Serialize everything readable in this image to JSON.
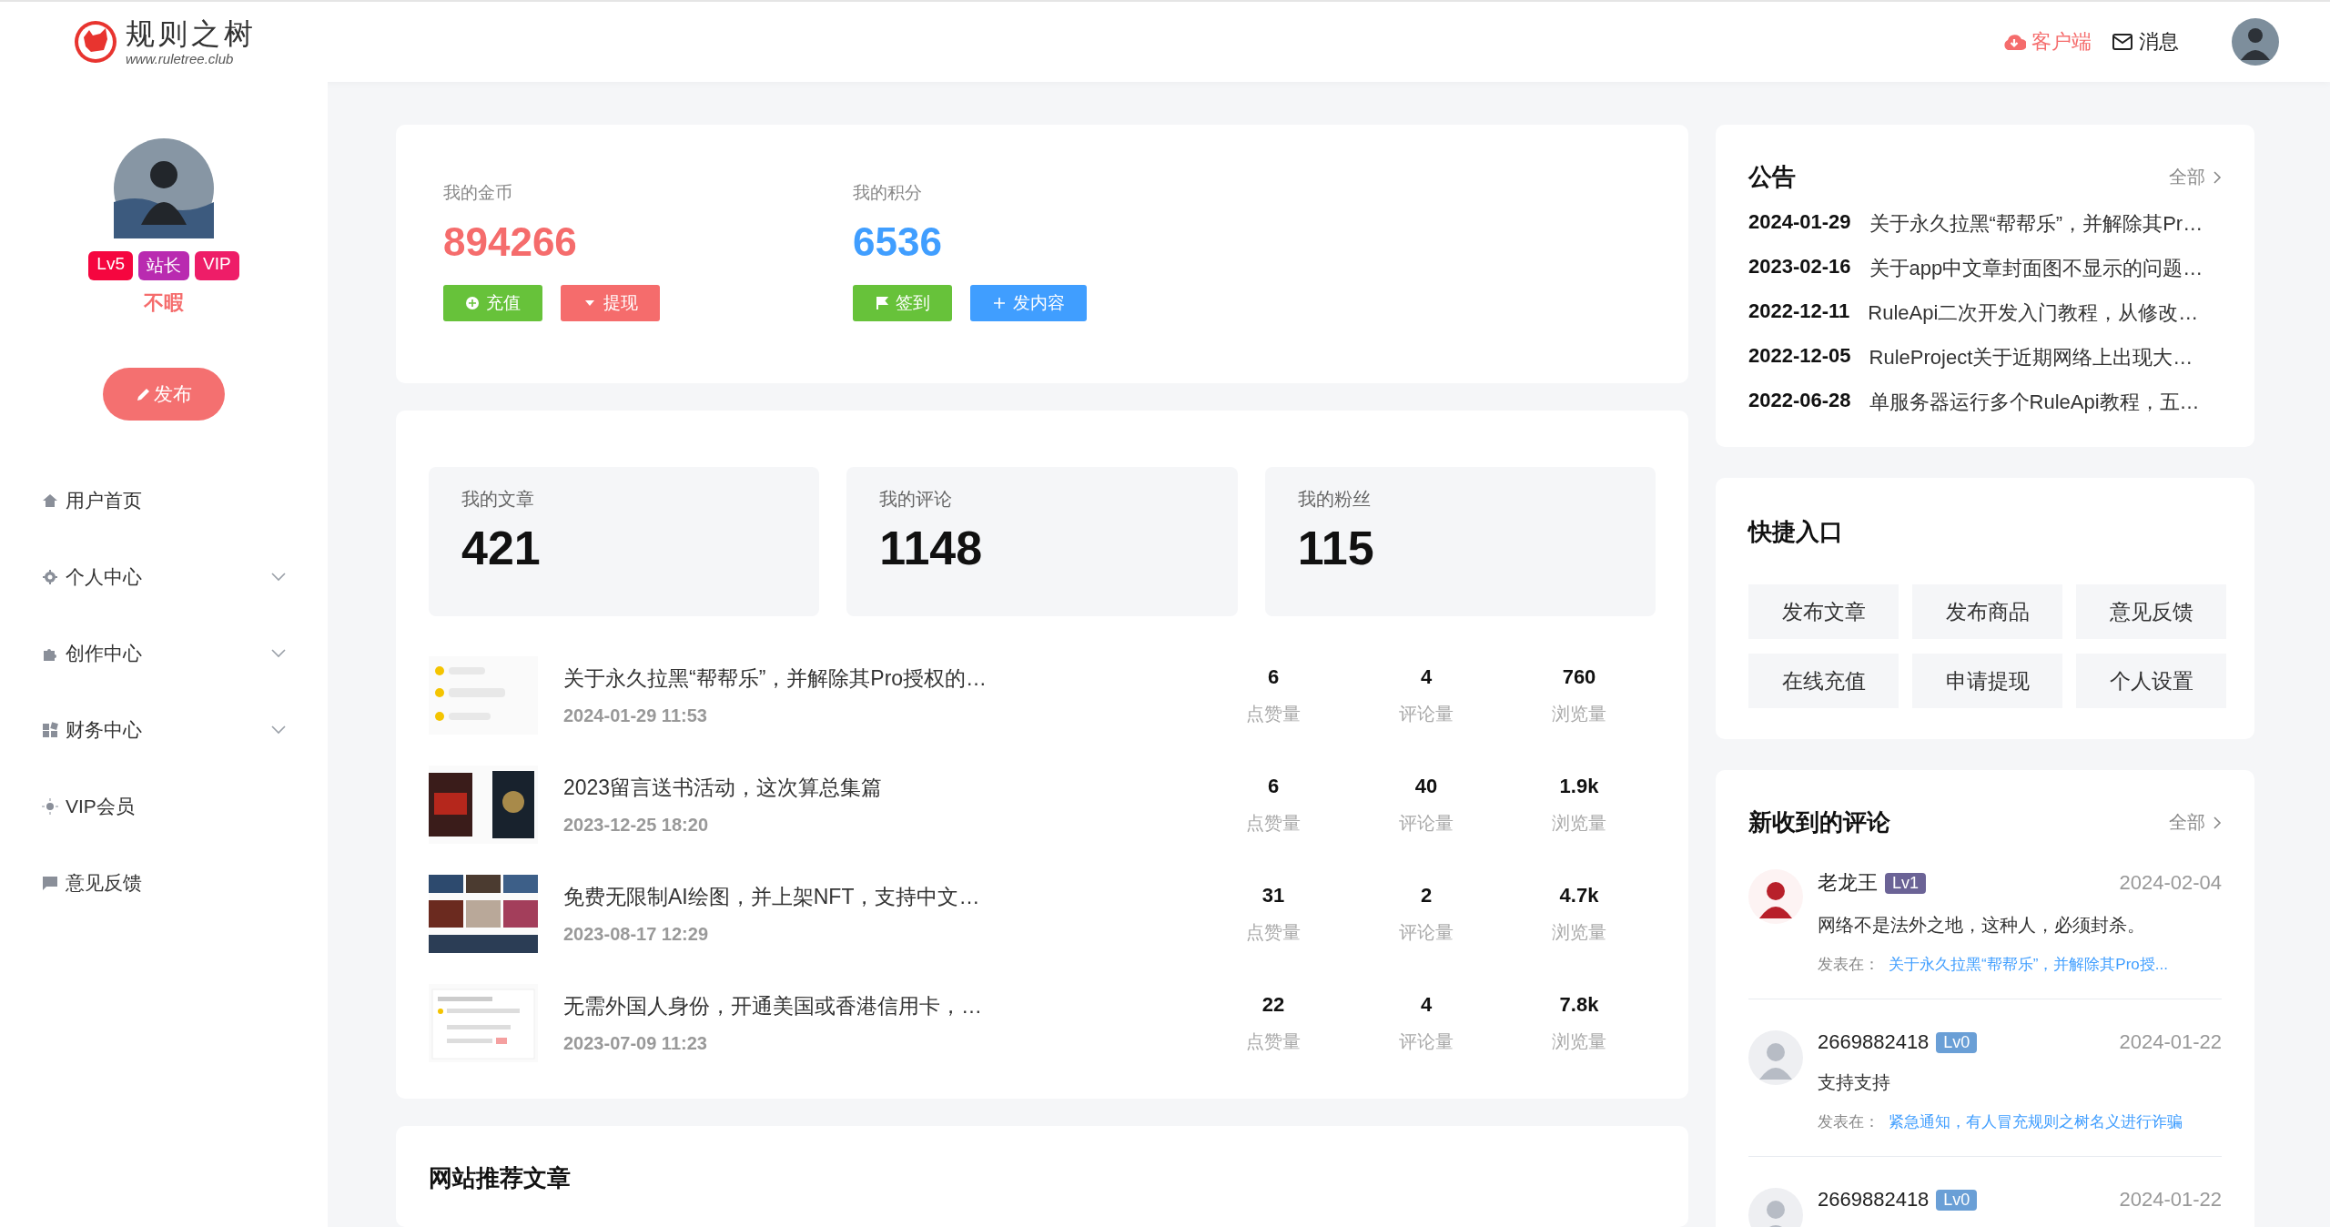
{
  "header": {
    "logo_title": "规则之树",
    "logo_url": "www.ruletree.club",
    "client_link": "客户端",
    "messages_link": "消息"
  },
  "profile": {
    "badges": [
      {
        "label": "Lv5",
        "color": "#f5063f"
      },
      {
        "label": "站长",
        "color": "#b92bb0"
      },
      {
        "label": "VIP",
        "color": "#ee1d68"
      }
    ],
    "name": "不暇",
    "publish_button": "发布"
  },
  "sidebar": {
    "items": [
      {
        "label": "用户首页",
        "expandable": false
      },
      {
        "label": "个人中心",
        "expandable": true
      },
      {
        "label": "创作中心",
        "expandable": true
      },
      {
        "label": "财务中心",
        "expandable": true
      },
      {
        "label": "VIP会员",
        "expandable": false
      },
      {
        "label": "意见反馈",
        "expandable": false
      }
    ]
  },
  "wallet": [
    {
      "label": "我的金币",
      "value": "894266",
      "color": "#f56c6c",
      "buttons": [
        {
          "label": "充值",
          "color": "#67c23a"
        },
        {
          "label": "提现",
          "color": "#f56c6c"
        }
      ]
    },
    {
      "label": "我的积分",
      "value": "6536",
      "color": "#409eff",
      "buttons": [
        {
          "label": "签到",
          "color": "#67c23a"
        },
        {
          "label": "发内容",
          "color": "#409eff"
        }
      ]
    }
  ],
  "stats": [
    {
      "label": "我的文章",
      "value": "421"
    },
    {
      "label": "我的评论",
      "value": "1148"
    },
    {
      "label": "我的粉丝",
      "value": "115"
    }
  ],
  "articles": [
    {
      "title": "关于永久拉黑“帮帮乐”，并解除其Pro授权的…",
      "date": "2024-01-29 11:53",
      "metrics": [
        {
          "value": "6",
          "label": "点赞量"
        },
        {
          "value": "4",
          "label": "评论量"
        },
        {
          "value": "760",
          "label": "浏览量"
        }
      ]
    },
    {
      "title": "2023留言送书活动，这次算总集篇",
      "date": "2023-12-25 18:20",
      "metrics": [
        {
          "value": "6",
          "label": "点赞量"
        },
        {
          "value": "40",
          "label": "评论量"
        },
        {
          "value": "1.9k",
          "label": "浏览量"
        }
      ]
    },
    {
      "title": "免费无限制AI绘图，并上架NFT，支持中文…",
      "date": "2023-08-17 12:29",
      "metrics": [
        {
          "value": "31",
          "label": "点赞量"
        },
        {
          "value": "2",
          "label": "评论量"
        },
        {
          "value": "4.7k",
          "label": "浏览量"
        }
      ]
    },
    {
      "title": "无需外国人身份，开通美国或香港信用卡，…",
      "date": "2023-07-09 11:23",
      "metrics": [
        {
          "value": "22",
          "label": "点赞量"
        },
        {
          "value": "4",
          "label": "评论量"
        },
        {
          "value": "7.8k",
          "label": "浏览量"
        }
      ]
    }
  ],
  "recommended": {
    "title": "网站推荐文章"
  },
  "notices": {
    "title": "公告",
    "more": "全部",
    "items": [
      {
        "date": "2024-01-29",
        "text": "关于永久拉黑“帮帮乐”，并解除其Pr…"
      },
      {
        "date": "2023-02-16",
        "text": "关于app中文章封面图不显示的问题…"
      },
      {
        "date": "2022-12-11",
        "text": "RuleApi二次开发入门教程，从修改…"
      },
      {
        "date": "2022-12-05",
        "text": "RuleProject关于近期网络上出现大…"
      },
      {
        "date": "2022-06-28",
        "text": "单服务器运行多个RuleApi教程，五…"
      }
    ]
  },
  "quick": {
    "title": "快捷入口",
    "buttons": [
      "发布文章",
      "发布商品",
      "意见反馈",
      "在线充值",
      "申请提现",
      "个人设置"
    ]
  },
  "comments": {
    "title": "新收到的评论",
    "more": "全部",
    "items": [
      {
        "user": "老龙王",
        "level": "Lv1",
        "color": "#6b6396",
        "date": "2024-02-04",
        "text": "网络不是法外之地，这种人，必须封杀。",
        "posted_label": "发表在：",
        "post_title": "关于永久拉黑“帮帮乐”，并解除其Pro授..."
      },
      {
        "user": "2669882418",
        "level": "Lv0",
        "color": "#6a9fd6",
        "date": "2024-01-22",
        "text": "支持支持",
        "posted_label": "发表在：",
        "post_title": "紧急通知，有人冒充规则之树名义进行诈骗"
      },
      {
        "user": "2669882418",
        "level": "Lv0",
        "color": "#6a9fd6",
        "date": "2024-01-22"
      }
    ]
  }
}
